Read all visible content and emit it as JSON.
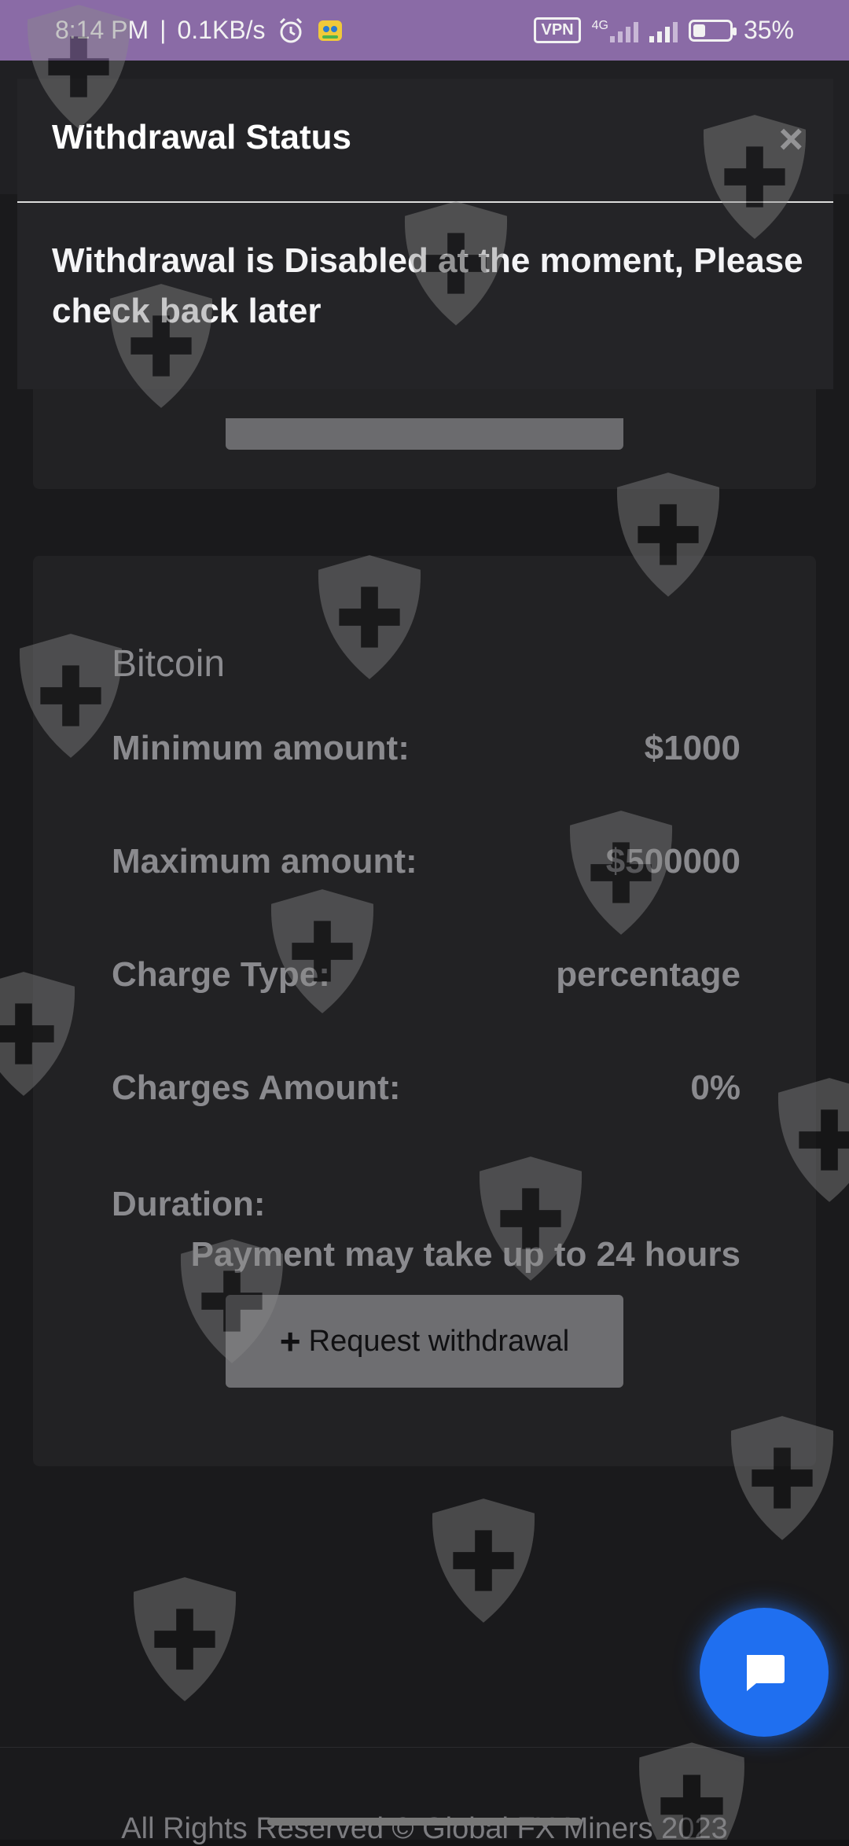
{
  "status_bar": {
    "time": "8:14 PM",
    "speed": "0.1KB/s",
    "vpn": "VPN",
    "network": "4G",
    "battery_percent": 35,
    "battery_label": "35%"
  },
  "modal": {
    "title": "Withdrawal Status",
    "close_glyph": "×",
    "message": "Withdrawal is Disabled at the moment, Please check back later"
  },
  "method": {
    "name": "Bitcoin",
    "rows": [
      {
        "label": "Minimum amount:",
        "value": "$1000"
      },
      {
        "label": "Maximum amount:",
        "value": "$500000"
      },
      {
        "label": "Charge Type:",
        "value": "percentage"
      },
      {
        "label": "Charges Amount:",
        "value": "0%"
      }
    ],
    "duration_label": "Duration:",
    "duration_value": "Payment may take up to 24 hours",
    "button_label": "Request withdrawal",
    "button_icon": "plus-icon"
  },
  "footer": {
    "text": "All Rights Reserved © Global FX Miners 2023"
  },
  "colors": {
    "status_bar": "#8a6ba6",
    "chat_button": "#1f6ff0",
    "modal_bg": "#242427"
  }
}
